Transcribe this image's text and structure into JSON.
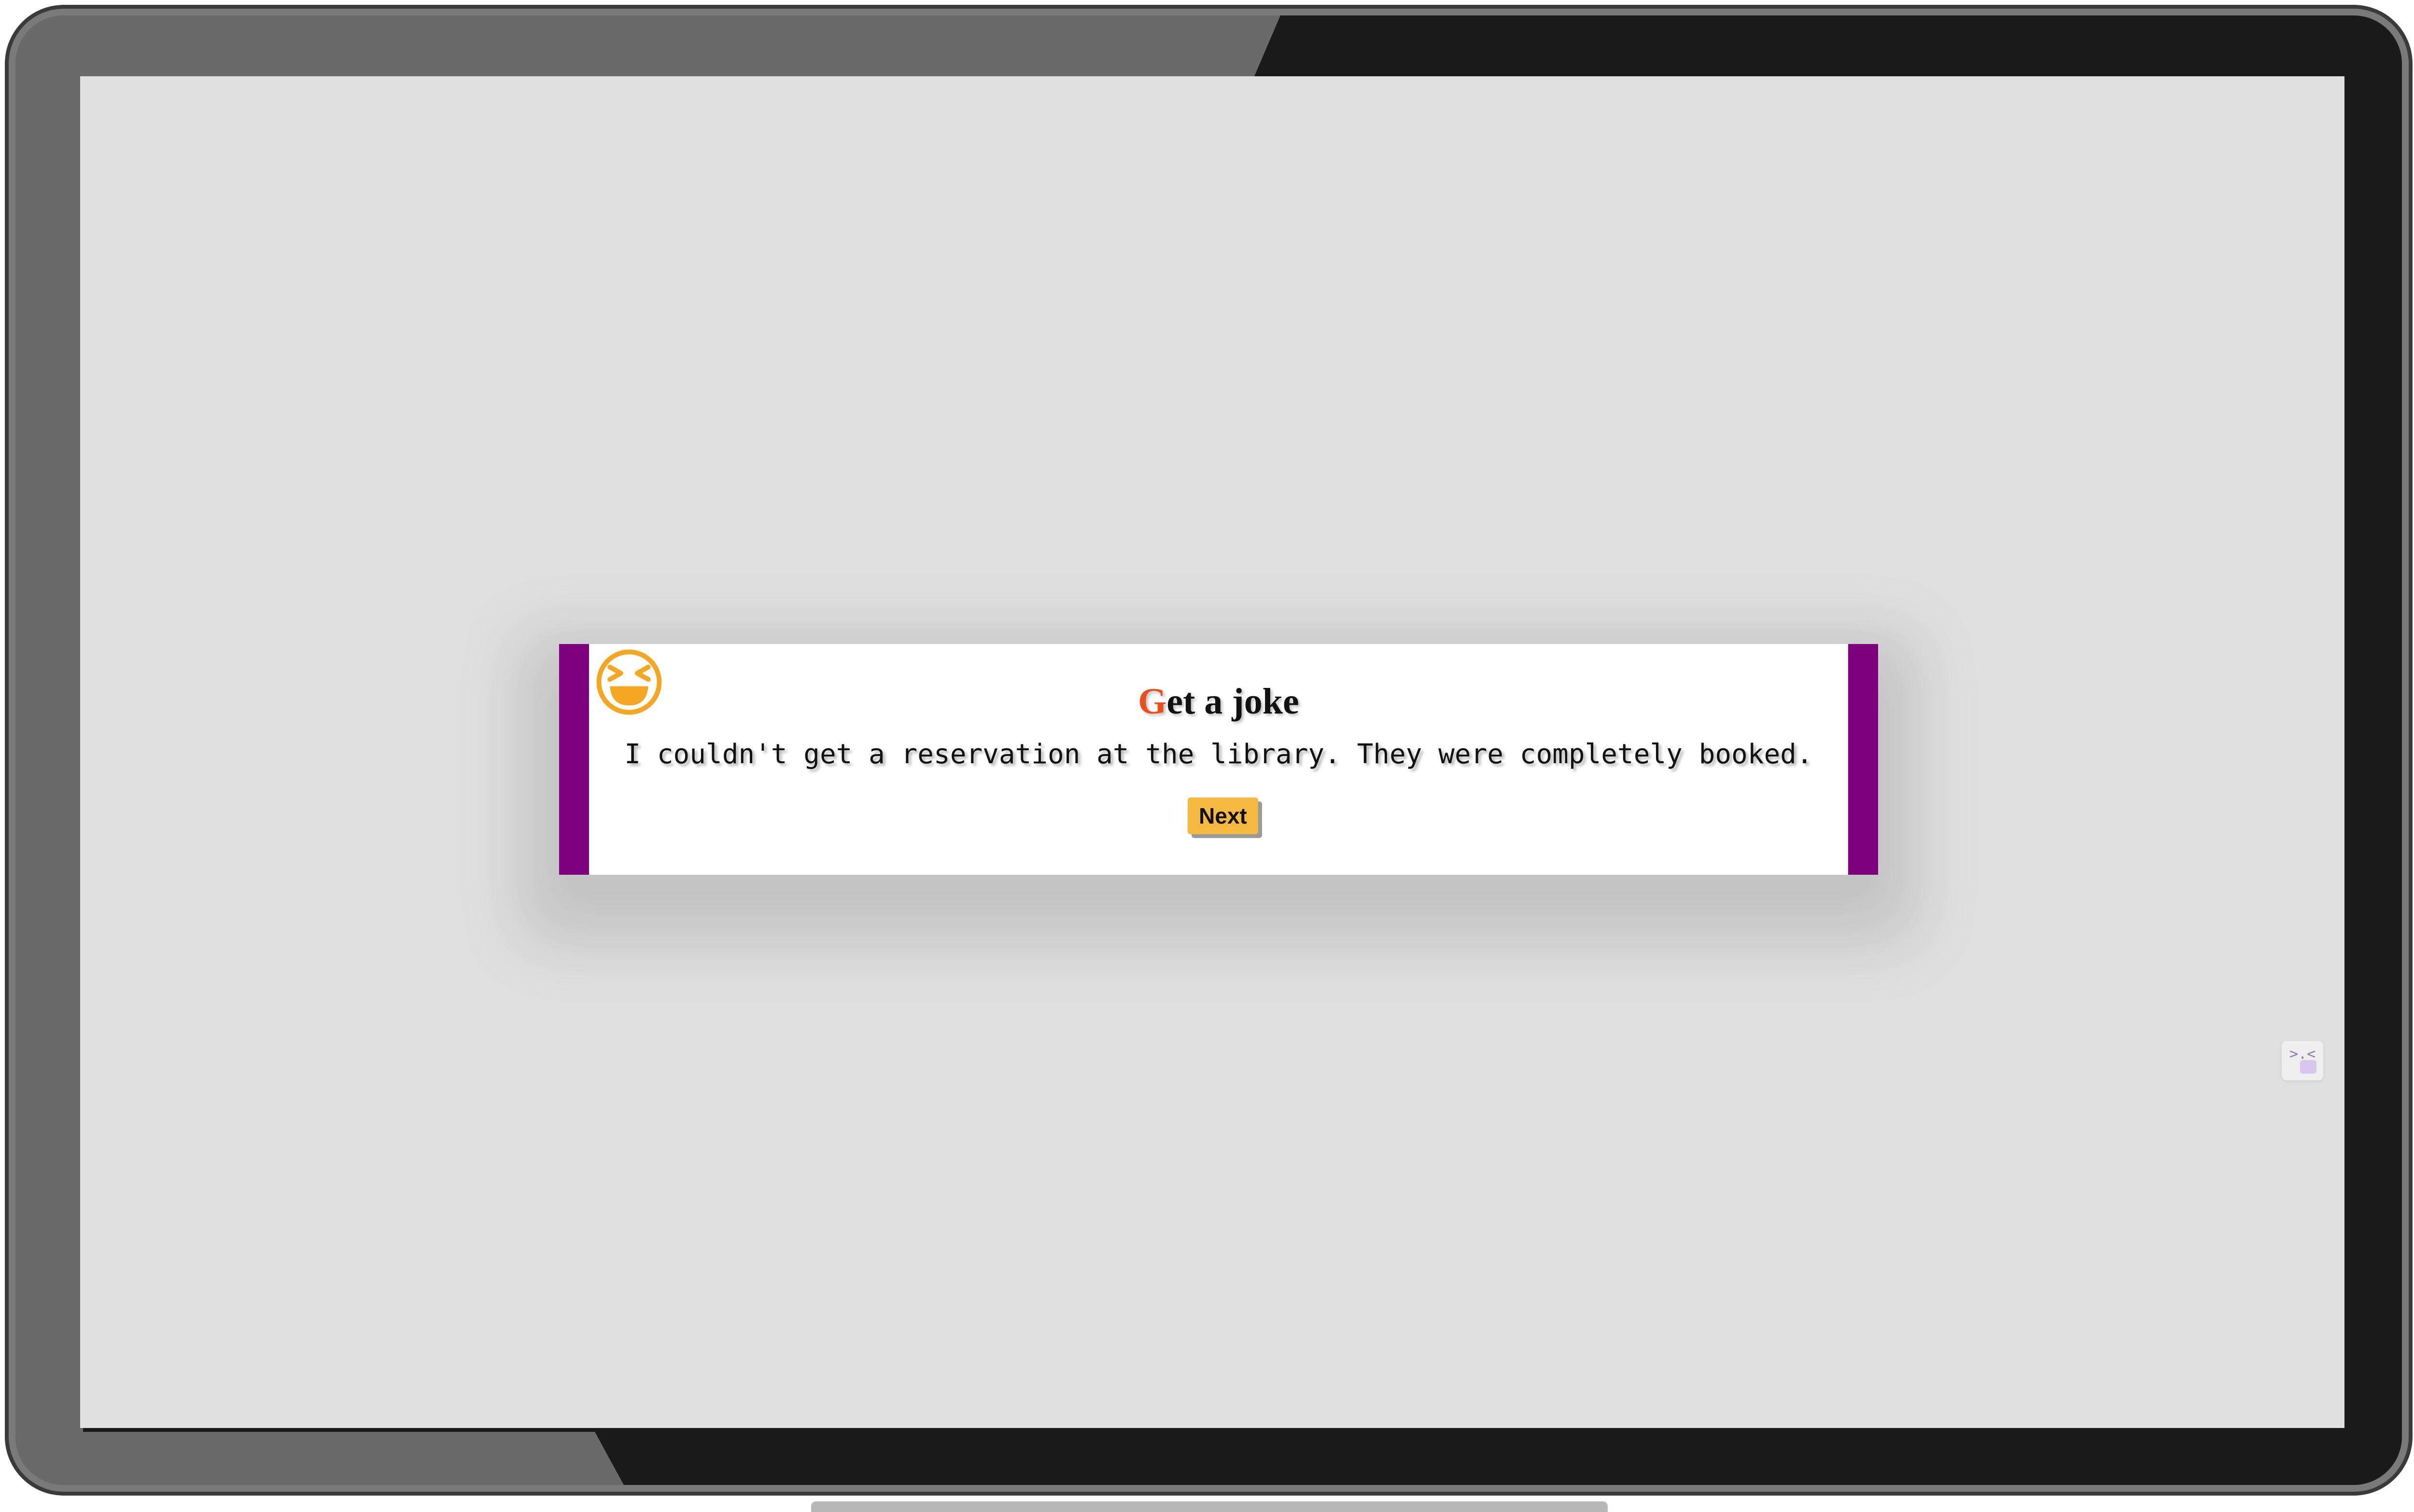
{
  "card": {
    "title_first_letter": "G",
    "title_rest": "et a joke",
    "joke_text": "I couldn't get a reservation at the library. They were completely booked.",
    "next_label": "Next",
    "emoji_icon": "laughing-face-icon"
  },
  "mini_widget": {
    "face": ">.<",
    "icon": "squint-face-icon"
  },
  "colors": {
    "accent_bar": "#7d007f",
    "title_first_letter": "#e94e1b",
    "button": "#f5b942",
    "emoji": "#f5a623",
    "screen_background": "#e0e0e0"
  }
}
